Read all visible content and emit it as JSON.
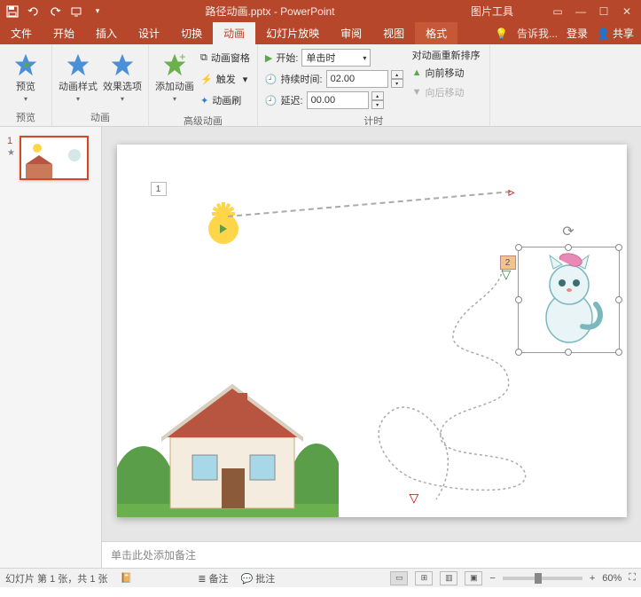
{
  "titlebar": {
    "doc_title": "路径动画.pptx - PowerPoint",
    "context_tool": "图片工具"
  },
  "tabs": {
    "file": "文件",
    "home": "开始",
    "insert": "插入",
    "design": "设计",
    "transitions": "切换",
    "animations": "动画",
    "slideshow": "幻灯片放映",
    "review": "审阅",
    "view": "视图",
    "format": "格式",
    "tell_me": "告诉我...",
    "login": "登录",
    "share": "共享"
  },
  "ribbon": {
    "preview": {
      "label": "预览",
      "group": "预览"
    },
    "anim": {
      "styles": "动画样式",
      "options": "效果选项",
      "group": "动画"
    },
    "advanced": {
      "add": "添加动画",
      "pane": "动画窗格",
      "trigger": "触发",
      "painter": "动画刷",
      "group": "高级动画"
    },
    "timing": {
      "start_label": "开始:",
      "start_value": "单击时",
      "duration_label": "持续时间:",
      "duration_value": "02.00",
      "delay_label": "延迟:",
      "delay_value": "00.00",
      "group": "计时"
    },
    "reorder": {
      "title": "对动画重新排序",
      "forward": "向前移动",
      "backward": "向后移动"
    }
  },
  "thumbs": {
    "num1": "1"
  },
  "slide": {
    "tag1": "1",
    "tag2": "2"
  },
  "notes": {
    "placeholder": "单击此处添加备注"
  },
  "status": {
    "slide_info": "幻灯片 第 1 张，共 1 张",
    "notes": "备注",
    "comments": "批注",
    "zoom": "60%"
  }
}
